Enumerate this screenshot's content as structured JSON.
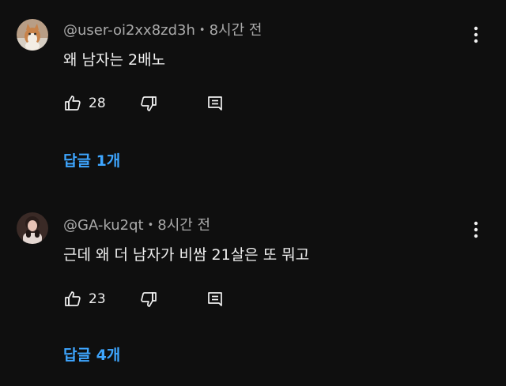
{
  "comments": [
    {
      "author": "@user-oi2xx8zd3h",
      "time": "8시간 전",
      "text": "왜 남자는 2배노",
      "likes": "28",
      "replies_label": "답글 1개",
      "avatar_icon": "cat-avatar-icon"
    },
    {
      "author": "@GA-ku2qt",
      "time": "8시간 전",
      "text": "근데 왜 더 남자가 비쌈 21살은 또 뭐고",
      "likes": "23",
      "replies_label": "답글 4개",
      "avatar_icon": "person-avatar-icon"
    }
  ],
  "separator": "•",
  "icons": {
    "like": "thumbs-up-icon",
    "dislike": "thumbs-down-icon",
    "reply": "reply-comment-icon",
    "more": "more-vertical-icon"
  },
  "colors": {
    "background": "#0f0f0f",
    "text": "#f1f1f1",
    "meta": "#aaaaaa",
    "link": "#3ea6ff"
  }
}
